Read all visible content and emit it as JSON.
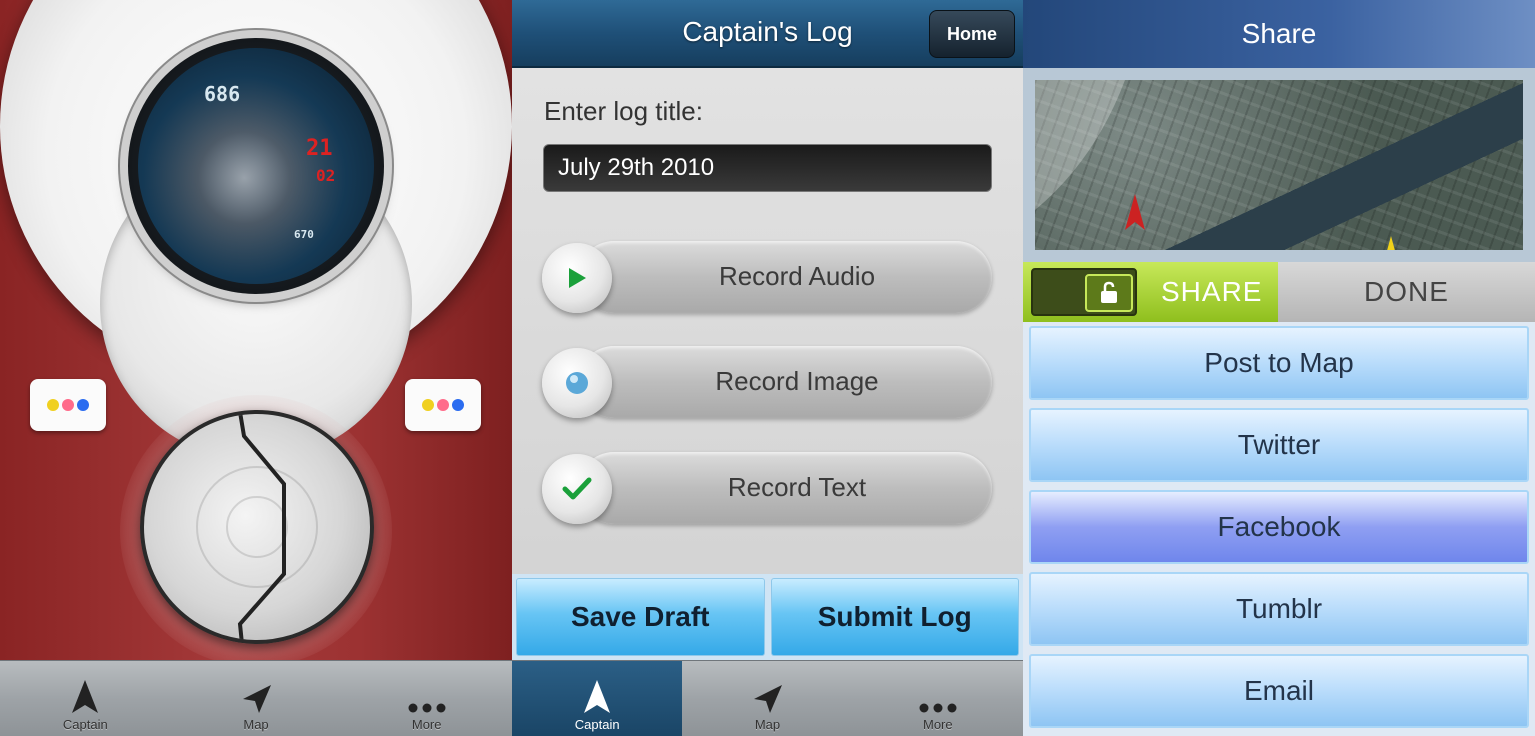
{
  "panel1": {
    "hud": {
      "top_number": "686",
      "small_number": "670"
    },
    "tabbar": [
      {
        "label": "Captain",
        "icon": "starfleet-delta-icon"
      },
      {
        "label": "Map",
        "icon": "navigation-arrow-icon"
      },
      {
        "label": "More",
        "icon": "more-dots-icon"
      }
    ],
    "led_colors": [
      "#f0d020",
      "#ff6b8a",
      "#2b6cf0"
    ]
  },
  "panel2": {
    "title": "Captain's Log",
    "home_button": "Home",
    "field_label": "Enter log title:",
    "log_title_value": "July 29th 2010",
    "records": [
      {
        "label": "Record Audio",
        "icon": "play-icon"
      },
      {
        "label": "Record Image",
        "icon": "blue-dot-icon"
      },
      {
        "label": "Record Text",
        "icon": "checkmark-icon"
      }
    ],
    "save_draft": "Save Draft",
    "submit_log": "Submit Log",
    "tabbar": [
      {
        "label": "Captain",
        "icon": "starfleet-delta-icon",
        "active": true
      },
      {
        "label": "Map",
        "icon": "navigation-arrow-icon"
      },
      {
        "label": "More",
        "icon": "more-dots-icon"
      }
    ]
  },
  "panel3": {
    "title": "Share",
    "toggle_share": "SHARE",
    "toggle_done": "DONE",
    "options": [
      "Post to Map",
      "Twitter",
      "Facebook",
      "Tumblr",
      "Email"
    ]
  },
  "colors": {
    "accent_blue": "#1f5078",
    "panel_red": "#9c3232",
    "toggle_green": "#8fbf1e"
  }
}
